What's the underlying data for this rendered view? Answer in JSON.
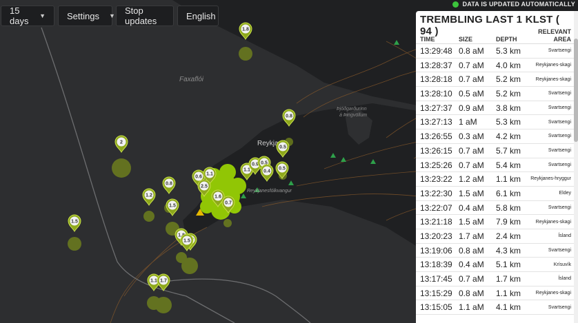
{
  "controls": {
    "period": "15 days",
    "settings": "Settings",
    "stop": "Stop updates",
    "language": "English"
  },
  "status": {
    "auto": "DATA IS UPDATED AUTOMATICALLY",
    "color": "#3cc43c"
  },
  "map_labels": {
    "bay": "Faxaflói",
    "city": "Reykjavík",
    "park_1": "Þjóðgarðurinn",
    "park_2": "á Þingvöllum",
    "peninsula": "Reykjanesfólkvangur"
  },
  "markers": {
    "m1": "1.8",
    "m2": "2",
    "m3": "0.8",
    "m4": "0.5",
    "m5": "1.1",
    "m6": "0.9",
    "m7": "0.5",
    "m8": "0.4",
    "m9": "0.5",
    "m10": "0.6",
    "m11": "1.1",
    "m12": "2.5",
    "m13": "1.6",
    "m14": "0.7",
    "m15": "0.8",
    "m16": "1.2",
    "m17": "1.5",
    "m18": "1.5",
    "m19": "1.8",
    "m20": "1.7",
    "m21": "1.5",
    "m22": "1.1",
    "m23": "1.7"
  },
  "panel": {
    "title": "TREMBLING LAST 1 KLST ( 94 )",
    "headers": {
      "time": "TIME",
      "size": "SIZE",
      "depth": "DEPTH",
      "area_1": "RELEVANT",
      "area_2": "AREA"
    },
    "rows": [
      {
        "time": "13:29:48",
        "size": "0.8 aM",
        "depth": "5.3 km",
        "area": "Svartsengi"
      },
      {
        "time": "13:28:37",
        "size": "0.7 aM",
        "depth": "4.0 km",
        "area": "Reykjanes-skagi"
      },
      {
        "time": "13:28:18",
        "size": "0.7 aM",
        "depth": "5.2 km",
        "area": "Reykjanes-skagi"
      },
      {
        "time": "13:28:10",
        "size": "0.5 aM",
        "depth": "5.2 km",
        "area": "Svartsengi"
      },
      {
        "time": "13:27:37",
        "size": "0.9 aM",
        "depth": "3.8 km",
        "area": "Svartsengi"
      },
      {
        "time": "13:27:13",
        "size": "1 aM",
        "depth": "5.3 km",
        "area": "Svartsengi"
      },
      {
        "time": "13:26:55",
        "size": "0.3 aM",
        "depth": "4.2 km",
        "area": "Svartsengi"
      },
      {
        "time": "13:26:15",
        "size": "0.7 aM",
        "depth": "5.7 km",
        "area": "Svartsengi"
      },
      {
        "time": "13:25:26",
        "size": "0.7 aM",
        "depth": "5.4 km",
        "area": "Svartsengi"
      },
      {
        "time": "13:23:22",
        "size": "1.2 aM",
        "depth": "1.1 km",
        "area": "Reykjanes-hryggur"
      },
      {
        "time": "13:22:30",
        "size": "1.5 aM",
        "depth": "6.1 km",
        "area": "Eldey"
      },
      {
        "time": "13:22:07",
        "size": "0.4 aM",
        "depth": "5.8 km",
        "area": "Svartsengi"
      },
      {
        "time": "13:21:18",
        "size": "1.5 aM",
        "depth": "7.9 km",
        "area": "Reykjanes-skagi"
      },
      {
        "time": "13:20:23",
        "size": "1.7 aM",
        "depth": "2.4 km",
        "area": "Ísland"
      },
      {
        "time": "13:19:06",
        "size": "0.8 aM",
        "depth": "4.3 km",
        "area": "Svartsengi"
      },
      {
        "time": "13:18:39",
        "size": "0.4 aM",
        "depth": "5.1 km",
        "area": "Krísuvík"
      },
      {
        "time": "13:17:45",
        "size": "0.7 aM",
        "depth": "1.7 km",
        "area": "Ísland"
      },
      {
        "time": "13:15:29",
        "size": "0.8 aM",
        "depth": "1.1 km",
        "area": "Reykjanes-skagi"
      },
      {
        "time": "13:15:05",
        "size": "1.1 aM",
        "depth": "4.1 km",
        "area": "Svartsengi"
      }
    ]
  }
}
